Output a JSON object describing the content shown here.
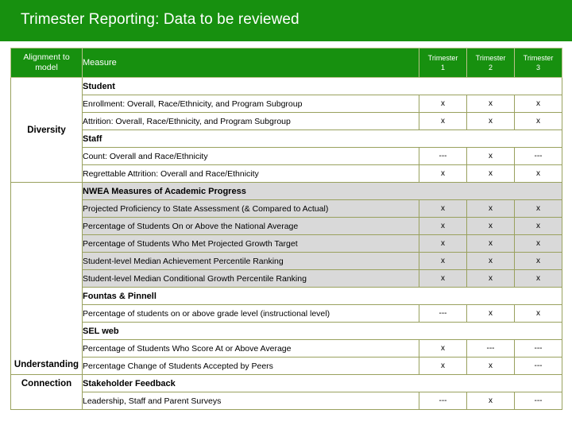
{
  "title": "Trimester Reporting: Data to be reviewed",
  "colors": {
    "banner_green": "#17900f",
    "table_border": "#99a15e",
    "shaded_row": "#d9d9d9",
    "text": "#000000"
  },
  "table": {
    "headers": {
      "alignment": "Alignment to model",
      "measure": "Measure",
      "trimester_1": "Trimester 1",
      "trimester_2": "Trimester 2",
      "trimester_3": "Trimester 3"
    },
    "alignment_groups": [
      {
        "label": "Diversity"
      },
      {
        "label": "Understanding"
      },
      {
        "label": "Connection"
      }
    ],
    "rows": [
      {
        "kind": "section",
        "label": "Student",
        "shade": "white"
      },
      {
        "kind": "measure",
        "label": "Enrollment: Overall, Race/Ethnicity, and Program Subgroup",
        "t1": "x",
        "t2": "x",
        "t3": "x",
        "shade": "white"
      },
      {
        "kind": "measure",
        "label": "Attrition: Overall, Race/Ethnicity, and Program Subgroup",
        "t1": "x",
        "t2": "x",
        "t3": "x",
        "shade": "white"
      },
      {
        "kind": "section",
        "label": "Staff",
        "shade": "white"
      },
      {
        "kind": "measure",
        "label": "Count: Overall and Race/Ethnicity",
        "t1": "---",
        "t2": "x",
        "t3": "---",
        "shade": "white"
      },
      {
        "kind": "measure",
        "label": "Regrettable Attrition: Overall and Race/Ethnicity",
        "t1": "x",
        "t2": "x",
        "t3": "x",
        "shade": "white"
      },
      {
        "kind": "section",
        "label": "NWEA Measures of Academic Progress",
        "shade": "gray"
      },
      {
        "kind": "measure",
        "label": "Projected Proficiency to State Assessment (& Compared to Actual)",
        "t1": "x",
        "t2": "x",
        "t3": "x",
        "shade": "gray"
      },
      {
        "kind": "measure",
        "label": "Percentage of Students On or Above the National Average",
        "t1": "x",
        "t2": "x",
        "t3": "x",
        "shade": "gray"
      },
      {
        "kind": "measure",
        "label": "Percentage of Students Who Met Projected Growth Target",
        "t1": "x",
        "t2": "x",
        "t3": "x",
        "shade": "gray"
      },
      {
        "kind": "measure",
        "label": "Student-level Median Achievement Percentile Ranking",
        "t1": "x",
        "t2": "x",
        "t3": "x",
        "shade": "gray"
      },
      {
        "kind": "measure",
        "label": "Student-level Median Conditional Growth Percentile Ranking",
        "t1": "x",
        "t2": "x",
        "t3": "x",
        "shade": "gray"
      },
      {
        "kind": "section",
        "label": "Fountas & Pinnell",
        "shade": "white"
      },
      {
        "kind": "measure",
        "label": "Percentage of students on or above grade level (instructional level)",
        "t1": "---",
        "t2": "x",
        "t3": "x",
        "shade": "white"
      },
      {
        "kind": "section",
        "label": "SEL web",
        "shade": "white"
      },
      {
        "kind": "measure",
        "label": "Percentage of Students Who Score At or Above Average",
        "t1": "x",
        "t2": "---",
        "t3": "---",
        "shade": "white"
      },
      {
        "kind": "measure",
        "label": "Percentage Change of Students Accepted by Peers",
        "t1": "x",
        "t2": "x",
        "t3": "---",
        "shade": "white"
      },
      {
        "kind": "section",
        "label": "Stakeholder Feedback",
        "shade": "white"
      },
      {
        "kind": "measure",
        "label": "Leadership, Staff and Parent Surveys",
        "t1": "---",
        "t2": "x",
        "t3": "---",
        "shade": "white"
      }
    ]
  }
}
